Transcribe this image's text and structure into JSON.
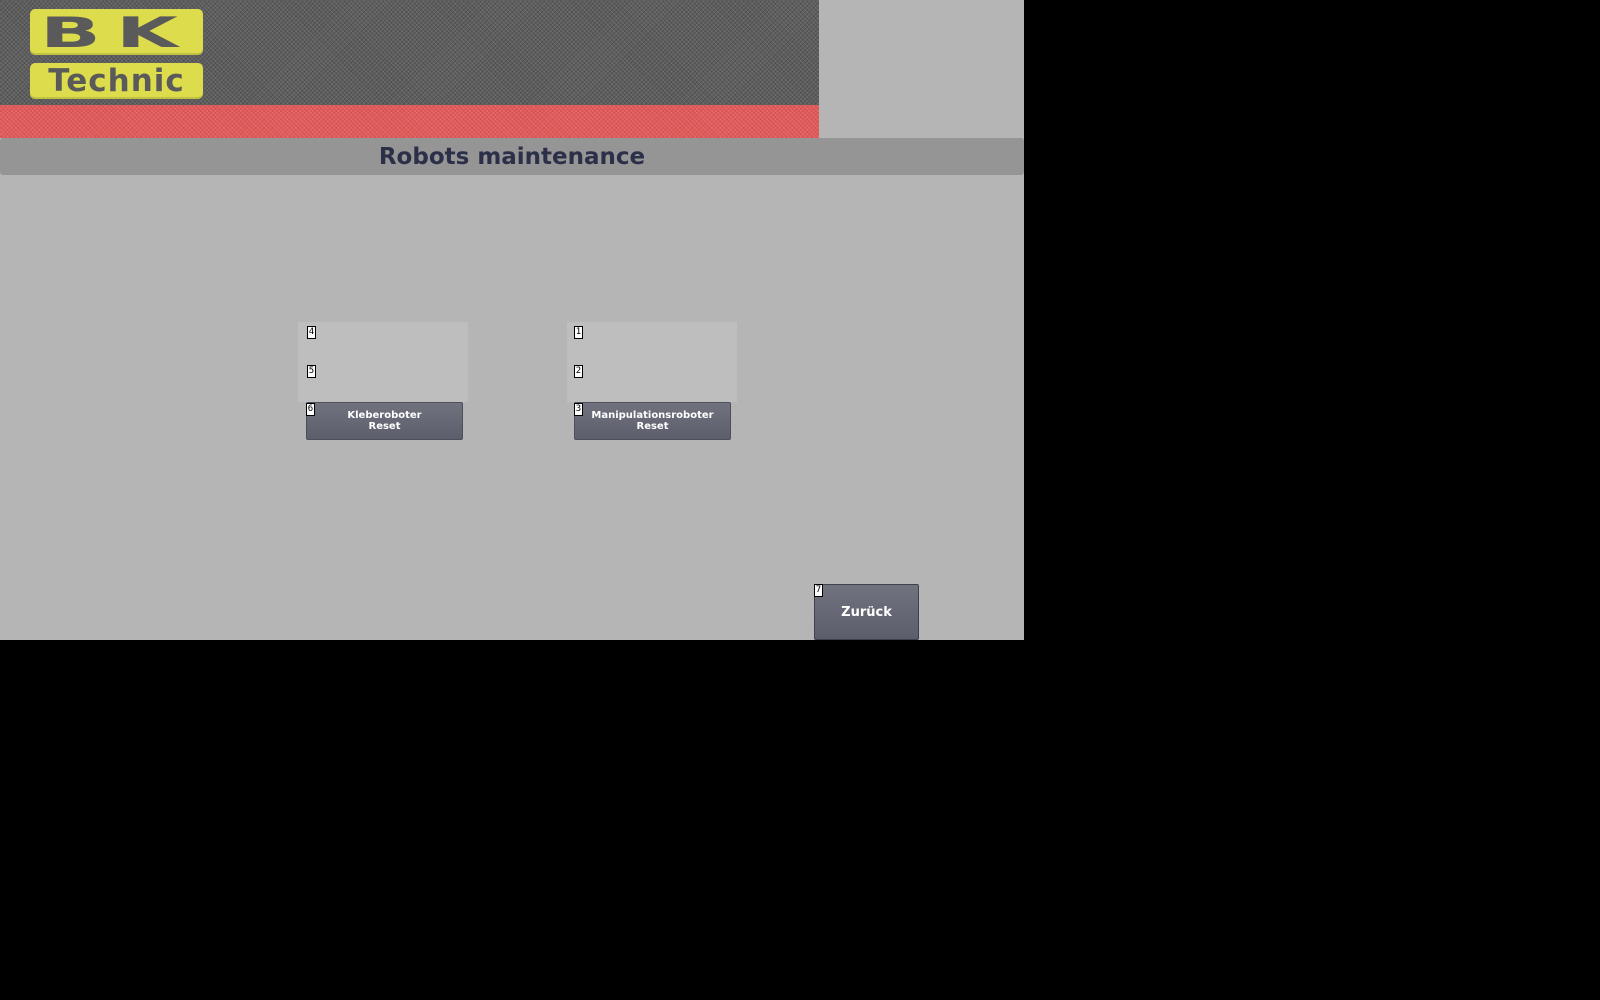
{
  "logo": {
    "top_text": "BK",
    "bottom_text": "Technic"
  },
  "title": "Robots maintenance",
  "panels": [
    {
      "tags": [
        "4",
        "5",
        "6"
      ],
      "button": {
        "line1": "Kleberoboter",
        "line2": "Reset"
      }
    },
    {
      "tags": [
        "1",
        "2",
        "3"
      ],
      "button": {
        "line1": "Manipulationsroboter",
        "line2": "Reset"
      }
    }
  ],
  "back_button": {
    "tag": "7",
    "label": "Zurück"
  },
  "colors": {
    "screen_background": "#b5b5b5",
    "header_pattern": "#5e5e5e",
    "accent_stripe": "#e05a5a",
    "logo_yellow": "#dcdc4c",
    "title_bar": "#959595",
    "title_text": "#2b2f48",
    "button": "#666875"
  }
}
